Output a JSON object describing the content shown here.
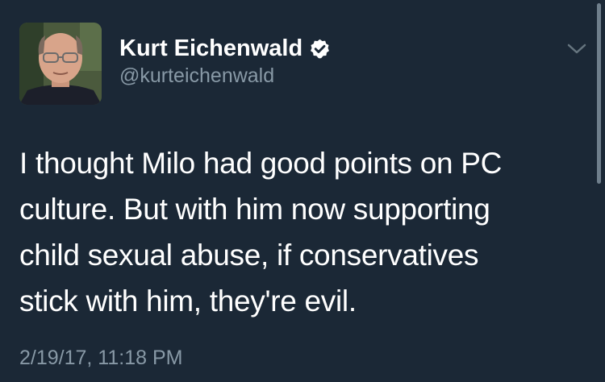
{
  "tweet": {
    "author": {
      "display_name": "Kurt Eichenwald",
      "handle": "@kurteichenwald",
      "verified": true,
      "avatar_icon": "avatar-photo"
    },
    "menu_icon": "chevron-down-icon",
    "text_lines": [
      "I thought Milo had good points on PC",
      "culture. But with him now supporting",
      "child sexual abuse, if conservatives",
      "stick with him, they're evil."
    ],
    "timestamp": "2/19/17, 11:18 PM"
  },
  "colors": {
    "background": "#1b2836",
    "text_primary": "#ffffff",
    "text_secondary": "#8899a6"
  }
}
